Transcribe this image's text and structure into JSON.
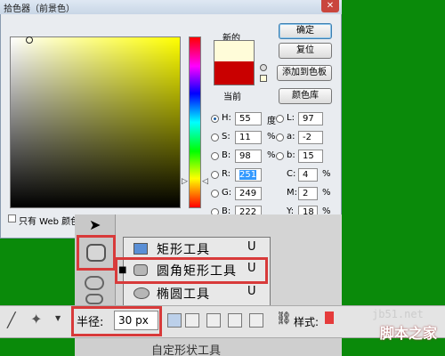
{
  "dialog": {
    "title": "拾色器（前景色）",
    "close": "✕",
    "new_label": "新的",
    "current_label": "当前",
    "buttons": {
      "ok": "确定",
      "reset": "复位",
      "add_swatches": "添加到色板",
      "color_libraries": "颜色库"
    },
    "web_only": "只有 Web 颜色"
  },
  "hsb": {
    "h": "55",
    "h_unit": "度",
    "s": "11",
    "s_unit": "%",
    "b": "98",
    "b_unit": "%"
  },
  "rgb": {
    "r": "251",
    "g": "249",
    "b": "222"
  },
  "lab": {
    "l": "97",
    "a": "-2",
    "b": "15"
  },
  "cmyk": {
    "c": "4",
    "c_unit": "%",
    "m": "2",
    "m_unit": "%",
    "y": "18",
    "y_unit": "%"
  },
  "field_labels": {
    "h": "H:",
    "s": "S:",
    "b": "B:",
    "r": "R:",
    "g": "G:",
    "bb": "B:",
    "l": "L:",
    "a": "a:",
    "lb": "b:",
    "c": "C:",
    "m": "M:",
    "y": "Y:"
  },
  "colors": {
    "new": "#fffcd9",
    "current": "#c90000",
    "highlight": "#d83a3a",
    "background": "#0a8a0a"
  },
  "flyout": {
    "items": [
      {
        "label": "矩形工具",
        "key": "U",
        "icon": "rectangle-icon"
      },
      {
        "label": "圆角矩形工具",
        "key": "U",
        "icon": "rounded-rectangle-icon"
      },
      {
        "label": "椭圆工具",
        "key": "U",
        "icon": "ellipse-icon"
      }
    ],
    "bottom_item": "自定形状工具"
  },
  "options_bar": {
    "radius_label": "半径:",
    "radius_value": "30 px",
    "style_label": "样式:"
  },
  "watermark": {
    "url": "jb51.net",
    "text": "脚本之家"
  }
}
